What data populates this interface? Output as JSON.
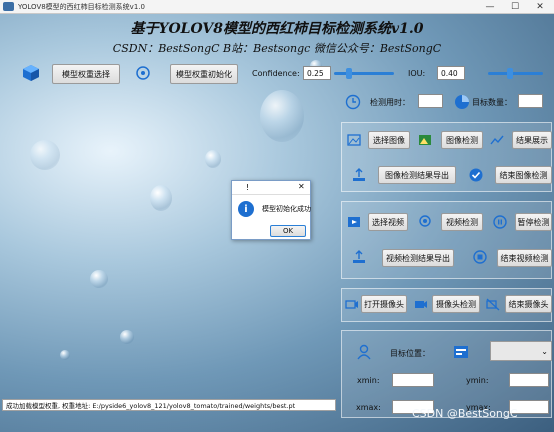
{
  "window": {
    "title": "YOLOV8模型的西红柿目标检测系统v1.0",
    "minimize_glyph": "—",
    "maximize_glyph": "☐",
    "close_glyph": "✕"
  },
  "header": {
    "title": "基于YOLOV8模型的西红柿目标检测系统v1.0",
    "subtitle": "CSDN：BestSongC   B站：Bestsongc   微信公众号：BestSongC"
  },
  "top_controls": {
    "select_weights_label": "模型权重选择",
    "init_weights_label": "模型权重初始化",
    "confidence_label": "Confidence:",
    "confidence_value": "0.25",
    "confidence_level": 0.25,
    "iou_label": "IOU:",
    "iou_value": "0.40",
    "iou_level": 0.4
  },
  "stats": {
    "detect_time_label": "检测用时：",
    "detect_time_value": "",
    "target_count_label": "目标数量：",
    "target_count_value": ""
  },
  "image_panel": {
    "select_image": "选择图像",
    "image_detect": "图像检测",
    "show_result": "结果展示",
    "export_image_result": "图像检测结果导出",
    "end_image_detect": "结束图像检测"
  },
  "video_panel": {
    "select_video": "选择视频",
    "video_detect": "视频检测",
    "pause_detect": "暂停检测",
    "export_video_result": "视频检测结果导出",
    "end_video_detect": "结束视频检测"
  },
  "camera_panel": {
    "open_camera": "打开摄像头",
    "camera_detect": "摄像头检测",
    "close_camera": "结束摄像头"
  },
  "location_panel": {
    "target_position_label": "目标位置：",
    "target_select_value": "",
    "xmin_label": "xmin:",
    "ymin_label": "ymin:",
    "xmax_label": "xmax:",
    "ymax_label": "ymax:",
    "xmin_value": "",
    "ymin_value": "",
    "xmax_value": "",
    "ymax_value": ""
  },
  "status_bar": {
    "text": "成功加载模型权重, 权重地址: E:/pyside6_yolov8_121/yolov8_tomato/trained/weights/best.pt"
  },
  "dialog": {
    "title": "!",
    "close_glyph": "✕",
    "message": "模型初始化成功",
    "ok_label": "OK",
    "info_glyph": "i"
  },
  "watermark": "CSDN @BestSongC",
  "colors": {
    "accent": "#2b7fd6",
    "panel_border": "#ffffff",
    "background_dark": "#3c5f7f",
    "background_light": "#e8f3fb"
  },
  "icons": {
    "app": "butterfly-icon",
    "weights": "cube-icon",
    "init": "target-icon",
    "time": "clock-icon",
    "count": "pie-chart-icon"
  }
}
